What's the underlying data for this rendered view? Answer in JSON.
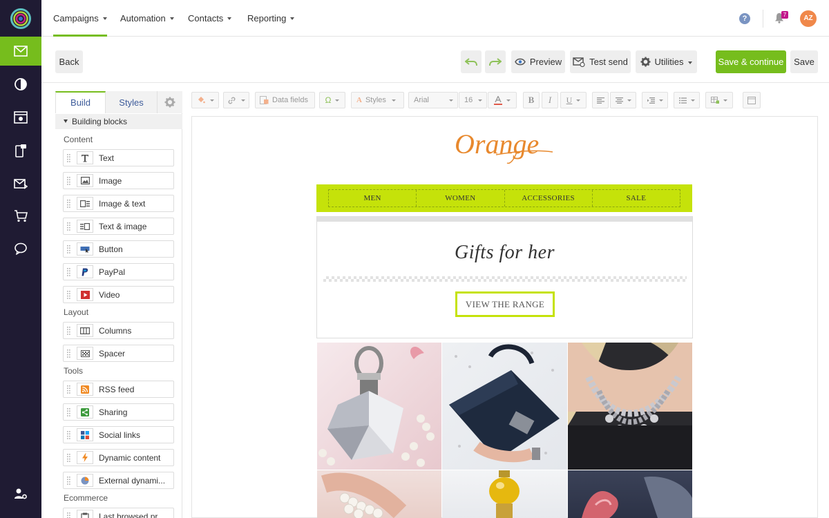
{
  "nav": {
    "items": [
      {
        "label": "Campaigns",
        "active": true
      },
      {
        "label": "Automation"
      },
      {
        "label": "Contacts"
      },
      {
        "label": "Reporting"
      }
    ],
    "help_glyph": "?",
    "notifications_count": "7",
    "avatar_initials": "AZ"
  },
  "actions": {
    "back": "Back",
    "preview": "Preview",
    "test_send": "Test send",
    "utilities": "Utilities",
    "save_continue": "Save & continue",
    "save": "Save"
  },
  "panel": {
    "tab_build": "Build",
    "tab_styles": "Styles",
    "section": "Building blocks",
    "groups": {
      "content": "Content",
      "layout": "Layout",
      "tools": "Tools",
      "ecommerce": "Ecommerce"
    },
    "blocks": {
      "text": "Text",
      "image": "Image",
      "image_text": "Image & text",
      "text_image": "Text & image",
      "button": "Button",
      "paypal": "PayPal",
      "video": "Video",
      "columns": "Columns",
      "spacer": "Spacer",
      "rss": "RSS feed",
      "sharing": "Sharing",
      "social": "Social links",
      "dynamic": "Dynamic content",
      "external": "External dynami...",
      "last_browsed": "Last browsed pr..."
    }
  },
  "editor": {
    "data_fields": "Data fields",
    "omega": "Ω",
    "styles": "Styles",
    "font": "Arial",
    "size": "16",
    "bold": "B",
    "italic": "I",
    "underline": "U"
  },
  "email": {
    "logo_text": "Orange",
    "menu": [
      "MEN",
      "WOMEN",
      "ACCESSORIES",
      "SALE"
    ],
    "headline": "Gifts for her",
    "cta": "VIEW THE RANGE"
  },
  "colors": {
    "brand_green": "#76bd1d",
    "rail_bg": "#1f1b33",
    "email_accent": "#c5e20a",
    "logo_orange": "#e8892e"
  }
}
